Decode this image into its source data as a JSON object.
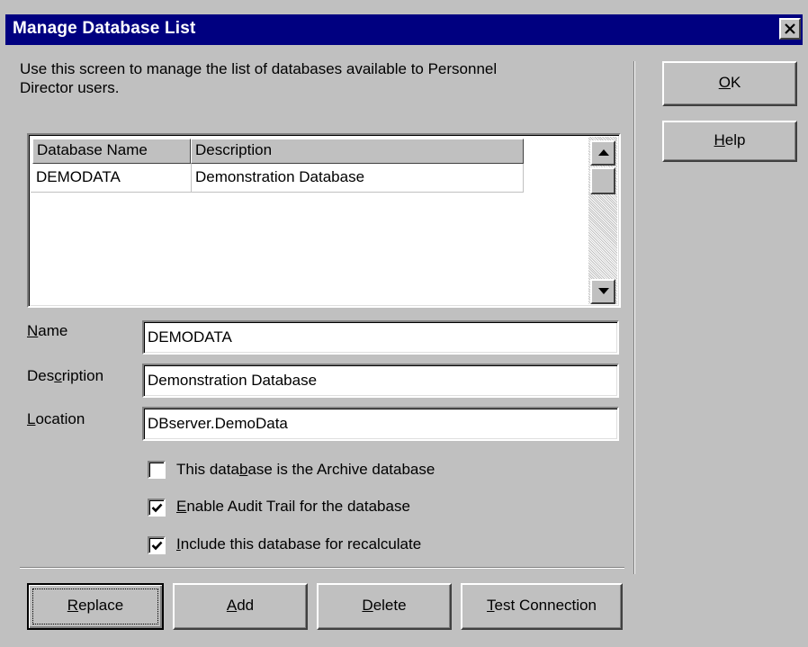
{
  "window": {
    "title": "Manage Database List"
  },
  "intro_text": [
    "Use this screen to manage the list of databases available to Personnel",
    "Director users."
  ],
  "table": {
    "columns": [
      "Database Name",
      "Description"
    ],
    "rows": [
      {
        "name": "DEMODATA",
        "description": "Demonstration Database"
      }
    ]
  },
  "form": {
    "name": {
      "label": "Name",
      "value": "DEMODATA"
    },
    "description": {
      "label": "Description",
      "value": "Demonstration Database"
    },
    "location": {
      "label": "Location",
      "value": "DBserver.DemoData"
    }
  },
  "checkboxes": [
    {
      "label": "This database is the Archive database",
      "checked": false
    },
    {
      "label": "Enable Audit Trail for the database",
      "checked": true
    },
    {
      "label": "Include this database for recalculate",
      "checked": true
    }
  ],
  "buttons": {
    "ok": "OK",
    "help": "Help",
    "replace": "Replace",
    "add": "Add",
    "delete": "Delete",
    "test_connection": "Test Connection"
  }
}
